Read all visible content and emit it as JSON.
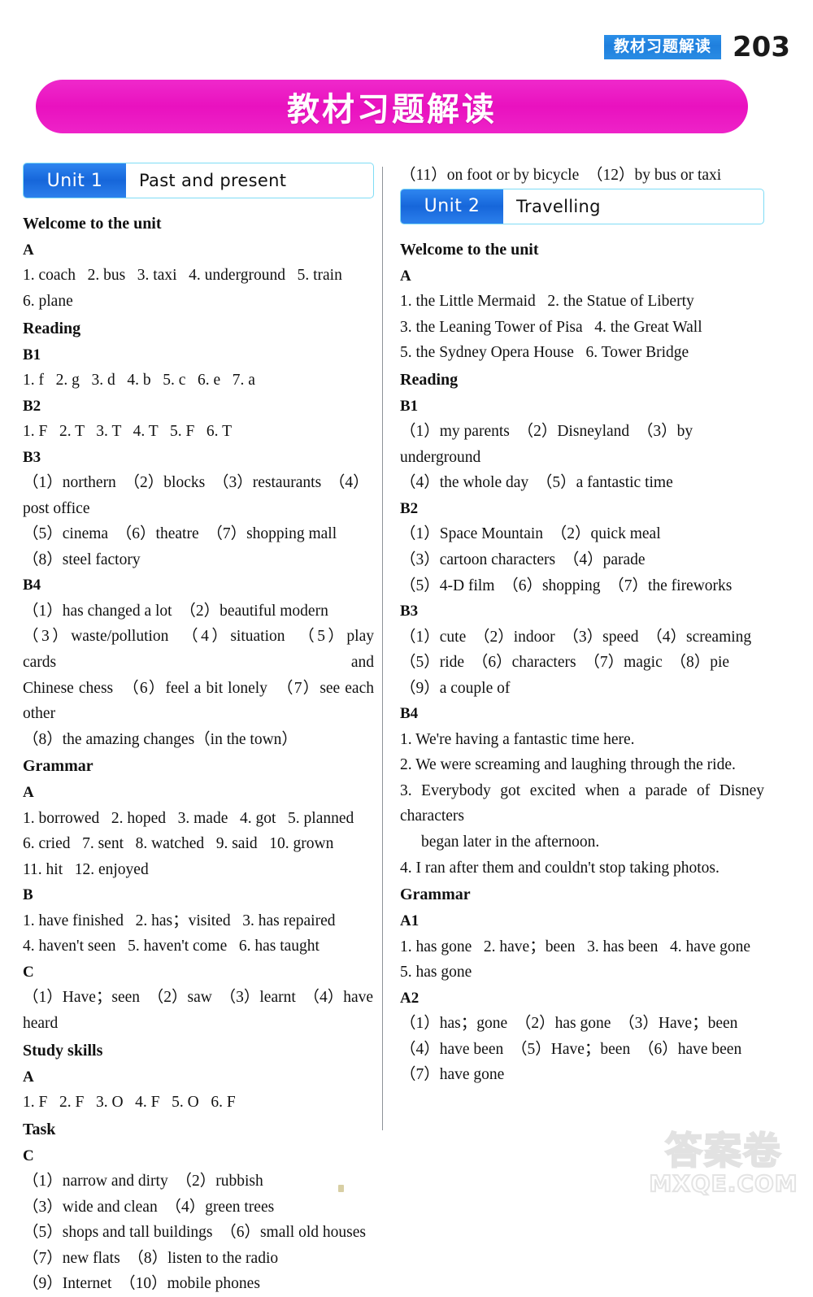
{
  "header": {
    "chapter_label": "教材习题解读",
    "page_number": "203"
  },
  "banner": {
    "title": "教材习题解读"
  },
  "watermark": {
    "chinese": "答案卷",
    "site": "MXQE.COM"
  },
  "left_column": {
    "unit": {
      "tag": "Unit 1",
      "title": "Past and present"
    },
    "blocks": [
      {
        "type": "section",
        "text": "Welcome to the unit"
      },
      {
        "type": "sub",
        "text": "A"
      },
      {
        "type": "line",
        "text": "1. coach   2. bus   3. taxi   4. underground   5. train"
      },
      {
        "type": "line",
        "text": "6. plane"
      },
      {
        "type": "section",
        "text": "Reading"
      },
      {
        "type": "sub",
        "text": "B1"
      },
      {
        "type": "line",
        "text": "1. f   2. g   3. d   4. b   5. c   6. e   7. a"
      },
      {
        "type": "sub",
        "text": "B2"
      },
      {
        "type": "line",
        "text": "1. F   2. T   3. T   4. T   5. F   6. T"
      },
      {
        "type": "sub",
        "text": "B3"
      },
      {
        "type": "line",
        "text": "（1）northern　（2）blocks　（3）restaurants　（4）post office"
      },
      {
        "type": "line",
        "text": "（5）cinema　（6）theatre　（7）shopping mall"
      },
      {
        "type": "line",
        "text": "（8）steel factory"
      },
      {
        "type": "sub",
        "text": "B4"
      },
      {
        "type": "line",
        "text": "（1）has changed a lot　（2）beautiful modern"
      },
      {
        "type": "justify",
        "text": "（3）waste/pollution　（4）situation　（5）play cards and"
      },
      {
        "type": "justify",
        "text": "Chinese chess　（6）feel a bit lonely　（7）see each other"
      },
      {
        "type": "line",
        "text": "（8）the amazing changes（in the town）"
      },
      {
        "type": "section",
        "text": "Grammar"
      },
      {
        "type": "sub",
        "text": "A"
      },
      {
        "type": "line",
        "text": "1. borrowed   2. hoped   3. made   4. got   5. planned"
      },
      {
        "type": "line",
        "text": "6. cried   7. sent   8. watched   9. said   10. grown"
      },
      {
        "type": "line",
        "text": "11. hit   12. enjoyed"
      },
      {
        "type": "sub",
        "text": "B"
      },
      {
        "type": "line",
        "text": "1. have finished   2. has；visited   3. has repaired"
      },
      {
        "type": "line",
        "text": "4. haven't seen   5. haven't come   6. has taught"
      },
      {
        "type": "sub",
        "text": "C"
      },
      {
        "type": "line",
        "text": "（1）Have；seen　（2）saw　（3）learnt　（4）have heard"
      },
      {
        "type": "section",
        "text": "Study skills"
      },
      {
        "type": "sub",
        "text": "A"
      },
      {
        "type": "line",
        "text": "1. F   2. F   3. O   4. F   5. O   6. F"
      },
      {
        "type": "section",
        "text": "Task"
      },
      {
        "type": "sub",
        "text": "C"
      },
      {
        "type": "line",
        "text": "（1）narrow and dirty　（2）rubbish"
      },
      {
        "type": "line",
        "text": "（3）wide and clean　（4）green trees"
      },
      {
        "type": "line",
        "text": "（5）shops and tall buildings　（6）small old houses"
      },
      {
        "type": "line",
        "text": "（7）new flats　（8）listen to the radio"
      },
      {
        "type": "line",
        "text": "（9）Internet　（10）mobile phones"
      }
    ]
  },
  "right_column": {
    "pre_unit_lines": [
      "（11）on foot or by bicycle　（12）by bus or taxi"
    ],
    "unit": {
      "tag": "Unit 2",
      "title": "Travelling"
    },
    "blocks": [
      {
        "type": "section",
        "text": "Welcome to the unit"
      },
      {
        "type": "sub",
        "text": "A"
      },
      {
        "type": "line",
        "text": "1. the Little Mermaid   2. the Statue of Liberty"
      },
      {
        "type": "line",
        "text": "3. the Leaning Tower of Pisa   4. the Great Wall"
      },
      {
        "type": "line",
        "text": "5. the Sydney Opera House   6. Tower Bridge"
      },
      {
        "type": "section",
        "text": "Reading"
      },
      {
        "type": "sub",
        "text": "B1"
      },
      {
        "type": "line",
        "text": "（1）my parents　（2）Disneyland　（3）by underground"
      },
      {
        "type": "line",
        "text": "（4）the whole day　（5）a fantastic time"
      },
      {
        "type": "sub",
        "text": "B2"
      },
      {
        "type": "line",
        "text": "（1）Space Mountain　（2）quick meal"
      },
      {
        "type": "line",
        "text": "（3）cartoon characters　（4）parade"
      },
      {
        "type": "line",
        "text": "（5）4-D film　（6）shopping　（7）the fireworks"
      },
      {
        "type": "sub",
        "text": "B3"
      },
      {
        "type": "line",
        "text": "（1）cute　（2）indoor　（3）speed　（4）screaming"
      },
      {
        "type": "line",
        "text": "（5）ride　（6）characters　（7）magic　（8）pie"
      },
      {
        "type": "line",
        "text": "（9）a couple of"
      },
      {
        "type": "sub",
        "text": "B4"
      },
      {
        "type": "line",
        "text": "1. We're having a fantastic time here."
      },
      {
        "type": "line",
        "text": "2. We were screaming and laughing through the ride."
      },
      {
        "type": "justify",
        "text": "3. Everybody got excited when a parade of Disney characters"
      },
      {
        "type": "indent",
        "text": "began later in the afternoon."
      },
      {
        "type": "line",
        "text": "4. I ran after them and couldn't stop taking photos."
      },
      {
        "type": "section",
        "text": "Grammar"
      },
      {
        "type": "sub",
        "text": "A1"
      },
      {
        "type": "line",
        "text": "1. has gone   2. have；been   3. has been   4. have gone"
      },
      {
        "type": "line",
        "text": "5. has gone"
      },
      {
        "type": "sub",
        "text": "A2"
      },
      {
        "type": "line",
        "text": "（1）has；gone　（2）has gone　（3）Have；been"
      },
      {
        "type": "line",
        "text": "（4）have been　（5）Have；been　（6）have been"
      },
      {
        "type": "line",
        "text": "（7）have gone"
      }
    ]
  }
}
